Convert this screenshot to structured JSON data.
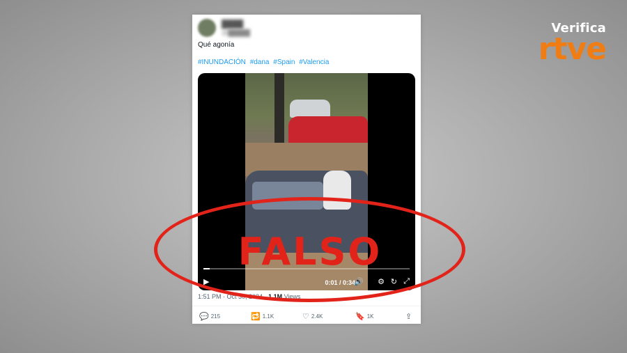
{
  "brand": {
    "top": "Verifica",
    "logo": "rtve"
  },
  "tweet": {
    "author_name": "████",
    "author_handle": "@█████",
    "text": "Qué agonía",
    "hashtags": [
      "#INUNDACIÓN",
      "#dana",
      "#Spain",
      "#Valencia"
    ],
    "video": {
      "time": "0:01 / 0:34",
      "progress": 0.03
    },
    "meta": {
      "time": "1:51 PM · Oct 30, 2024 · ",
      "views": "1.1M",
      "views_label": " Views"
    },
    "actions": {
      "replies": "215",
      "reposts": "1.1K",
      "likes": "2.4K",
      "bookmarks": "1K"
    }
  },
  "stamp": {
    "text": "FALSO"
  },
  "colors": {
    "brand_orange": "#f07d14",
    "stamp_red": "#e2231a",
    "link_blue": "#1d9bf0"
  }
}
